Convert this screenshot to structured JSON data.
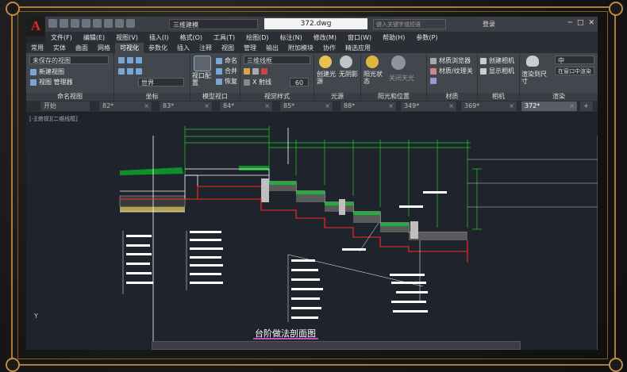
{
  "app": {
    "logo": "A",
    "workspace": "三维建模",
    "filename": "372.dwg",
    "search_placeholder": "键入关键字或短语",
    "login": "登录"
  },
  "menu": [
    "文件(F)",
    "编辑(E)",
    "视图(V)",
    "插入(I)",
    "格式(O)",
    "工具(T)",
    "绘图(D)",
    "标注(N)",
    "修改(M)",
    "窗口(W)",
    "帮助(H)",
    "参数(P)"
  ],
  "ribbon_tabs": [
    "常用",
    "实体",
    "曲面",
    "网格",
    "可视化",
    "参数化",
    "插入",
    "注释",
    "视图",
    "管理",
    "输出",
    "附加模块",
    "协作",
    "精选应用"
  ],
  "ribbon_active_tab": "可视化",
  "ribbon": {
    "named_views": {
      "dropdown": "未保存的视图",
      "new_view": "新建视图",
      "view_manager": "视图 管理器",
      "label": "命名视图"
    },
    "coords": {
      "world": "世界",
      "label": "坐标"
    },
    "model_viewports": {
      "viewport_config": "视口配置",
      "named": "命名",
      "merge": "合并",
      "restore": "恢复",
      "label": "模型视口"
    },
    "visual_styles": {
      "dropdown": "三维线框",
      "xray": "X 射线",
      "value": "60",
      "label": "视觉样式"
    },
    "lights": {
      "create_light": "创建光源",
      "no_shadow": "无阴影",
      "label": "光源"
    },
    "sun_location": {
      "sun_state": "阳光状态",
      "sky_off": "关闭天光",
      "label": "阳光和位置"
    },
    "materials": {
      "browser": "材质浏览器",
      "mapping": "材质/纹理关",
      "label": "材质"
    },
    "camera": {
      "create": "创建相机",
      "show": "显示相机",
      "label": "相机"
    },
    "render": {
      "render_to_size": "渲染到尺寸",
      "quality": "中",
      "in_window": "在窗口中渲染",
      "label": "渲染"
    }
  },
  "doc_tabs": [
    "开始",
    "82*",
    "83*",
    "84*",
    "85*",
    "88*",
    "349*",
    "369*",
    "372*"
  ],
  "doc_tab_active": "372*",
  "viewport_label": "[-][俯视][二维线框]",
  "drawing_title": "台阶做法剖面图",
  "ucs_label": "Y",
  "colors": {
    "accent": "#b07a3a",
    "green": "#1fd11f",
    "red": "#ff2a2a",
    "white": "#ffffff",
    "magenta": "#c64fc6"
  }
}
